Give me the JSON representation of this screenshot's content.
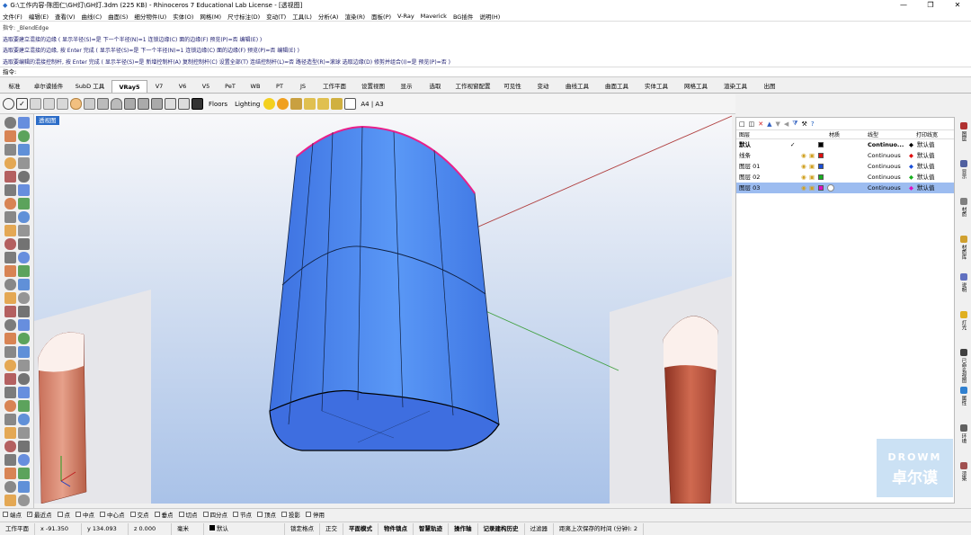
{
  "window": {
    "title": "G:\\工作内容-陈图仁\\GH灯\\GH灯.3dm (225 KB) - Rhinoceros 7 Educational Lab License - [透视图]",
    "controls": [
      "—",
      "❐",
      "✕"
    ]
  },
  "menu": [
    "文件(F)",
    "编辑(E)",
    "查看(V)",
    "曲线(C)",
    "曲面(S)",
    "细分物件(U)",
    "实体(O)",
    "网格(M)",
    "尺寸标注(D)",
    "变动(T)",
    "工具(L)",
    "分析(A)",
    "渲染(R)",
    "面板(P)",
    "V-Ray",
    "Maverick",
    "BG插件",
    "说明(H)"
  ],
  "command_history": [
    "指令: _BlendEdge",
    "选取要建立混接的边缘 ( 显示半径(S)=是  下一个半径(N)=1  连锁边缘(C)  面的边缘(F)  预览(P)=否  编辑(E) )",
    "选取要建立混接的边缘, 按 Enter 完成 ( 显示半径(S)=是  下一个半径(N)=1  连锁边缘(C)  面的边缘(F)  预览(P)=否  编辑(E) )",
    "选取要编辑的混接控制杆, 按 Enter 完成 ( 显示半径(S)=是  新增控制杆(A)  复制控制杆(C)  设置全部(T)  连结控制杆(L)=否  路径造型(R)=滚球  选取边缘(D)  修剪并组合(I)=是  预览(P)=否 )"
  ],
  "prompt": "指令:",
  "tabs": [
    "标准",
    "卓尔谟插件",
    "SubD 工具",
    "VRay5",
    "V7",
    "V6",
    "V5",
    "PeT",
    "WB",
    "PT",
    "JS",
    "工作平面",
    "设置视图",
    "显示",
    "选取",
    "工作视窗配置",
    "可见性",
    "变动",
    "曲线工具",
    "曲面工具",
    "实体工具",
    "网格工具",
    "渲染工具",
    "出图"
  ],
  "active_tab": "VRay5",
  "toolbar": {
    "floors": "Floors",
    "lighting": "Lighting",
    "page": "A4 | A3"
  },
  "viewport": {
    "label": "透视图"
  },
  "layers": {
    "headers": {
      "name": "图层",
      "material": "材质",
      "linetype": "线型",
      "print": "打印线宽"
    },
    "rows": [
      {
        "name": "默认",
        "check": "✓",
        "color": "#000000",
        "linetype": "Continuo...",
        "print": "默认值",
        "bold": true,
        "selected": false
      },
      {
        "name": "线条",
        "check": "",
        "color": "#e01010",
        "linetype": "Continuous",
        "print": "默认值",
        "bold": false,
        "selected": false
      },
      {
        "name": "图层 01",
        "check": "",
        "color": "#1a4fd8",
        "linetype": "Continuous",
        "print": "默认值",
        "bold": false,
        "selected": false
      },
      {
        "name": "图层 02",
        "check": "",
        "color": "#18b020",
        "linetype": "Continuous",
        "print": "默认值",
        "bold": false,
        "selected": false
      },
      {
        "name": "图层 03",
        "check": "",
        "color": "#e010c0",
        "linetype": "Continuous",
        "print": "默认值",
        "bold": false,
        "selected": true
      }
    ]
  },
  "right_tabs": [
    "图层",
    "显示",
    "材质",
    "材质库",
    "说明",
    "灯光",
    "已命名视图",
    "属性",
    "环境",
    "渲染"
  ],
  "osnaps": [
    {
      "label": "端点",
      "on": false
    },
    {
      "label": "最近点",
      "on": true
    },
    {
      "label": "点",
      "on": false
    },
    {
      "label": "中点",
      "on": false
    },
    {
      "label": "中心点",
      "on": false
    },
    {
      "label": "交点",
      "on": false
    },
    {
      "label": "垂点",
      "on": false
    },
    {
      "label": "切点",
      "on": false
    },
    {
      "label": "四分点",
      "on": false
    },
    {
      "label": "节点",
      "on": false
    },
    {
      "label": "顶点",
      "on": false
    },
    {
      "label": "投影",
      "on": false
    },
    {
      "label": "停用",
      "on": false
    }
  ],
  "status": {
    "cplane": "工作平面",
    "x": "x -91.350",
    "y": "y 134.093",
    "z": "z 0.000",
    "unit": "毫米",
    "layer": "默认",
    "items": [
      "锁定格点",
      "正交",
      "平面模式",
      "物件锁点",
      "智慧轨迹",
      "操作轴",
      "记录建构历史",
      "过滤器",
      "距离上次保存的时间 (分钟): 2"
    ]
  },
  "watermark": {
    "line1": "DROWM",
    "line2": "卓尔谟"
  },
  "colors": {
    "surface": "#4a86f0",
    "edge_highlight": "#e8208a",
    "selection": "#9cbcf0"
  }
}
